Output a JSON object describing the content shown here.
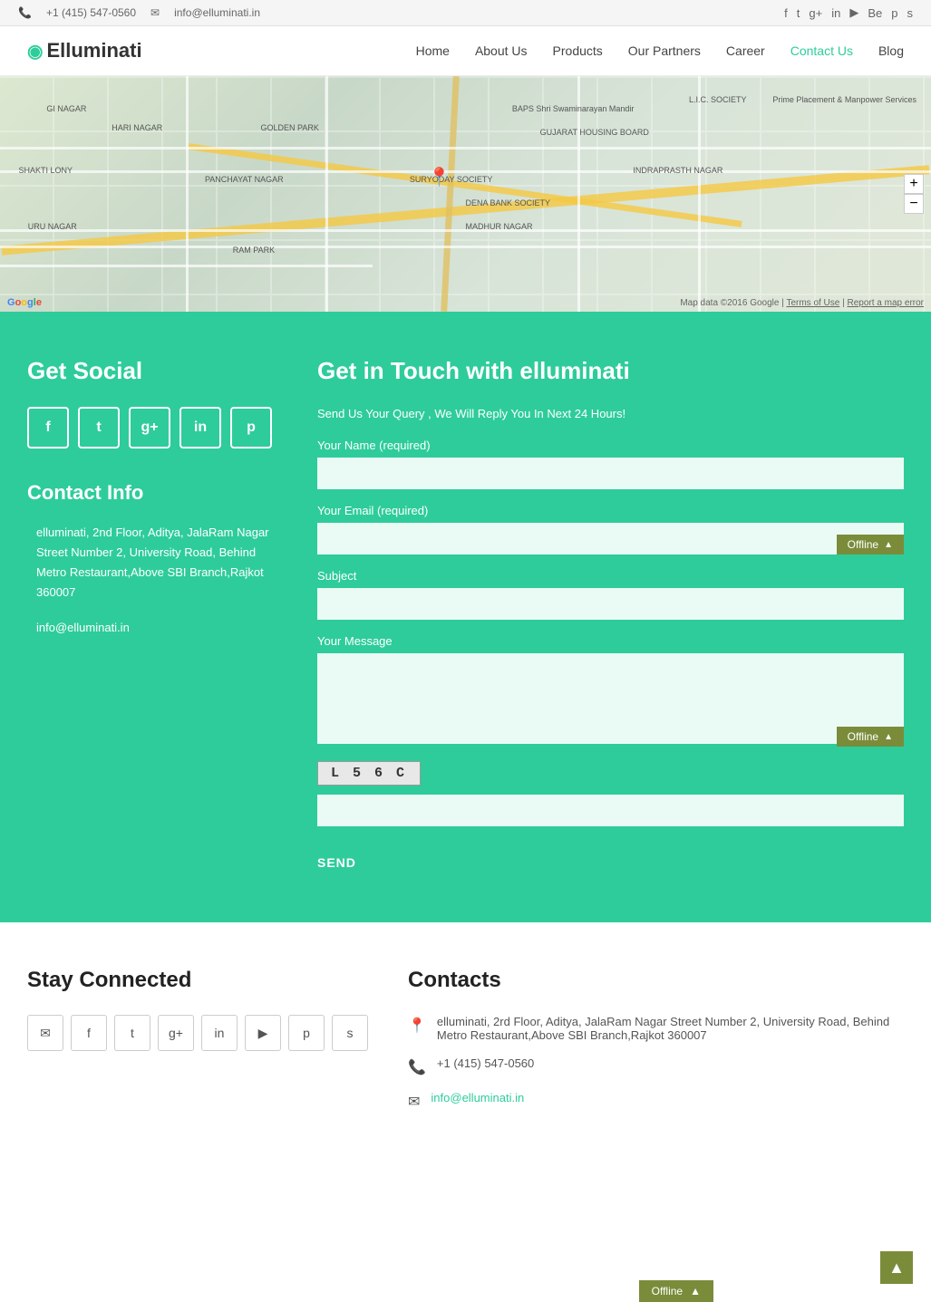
{
  "topbar": {
    "phone": "+1 (415) 547-0560",
    "email": "info@elluminati.in",
    "social_icons": [
      "f",
      "t",
      "g+",
      "in",
      "▶",
      "Be",
      "p",
      "s"
    ]
  },
  "navbar": {
    "logo_text": "Elluminati",
    "links": [
      {
        "label": "Home",
        "active": false
      },
      {
        "label": "About Us",
        "active": false
      },
      {
        "label": "Products",
        "active": false
      },
      {
        "label": "Our Partners",
        "active": false
      },
      {
        "label": "Career",
        "active": false
      },
      {
        "label": "Contact Us",
        "active": true
      },
      {
        "label": "Blog",
        "active": false
      }
    ]
  },
  "map": {
    "copyright": "Map data ©2016 Google",
    "terms": "Terms of Use",
    "report": "Report a map error"
  },
  "get_social": {
    "title": "Get Social",
    "icons": [
      {
        "name": "facebook",
        "symbol": "f"
      },
      {
        "name": "twitter",
        "symbol": "t"
      },
      {
        "name": "google-plus",
        "symbol": "g+"
      },
      {
        "name": "linkedin",
        "symbol": "in"
      },
      {
        "name": "pinterest",
        "symbol": "p"
      }
    ]
  },
  "contact_info": {
    "title": "Contact Info",
    "address": "elluminati, 2nd Floor, Aditya, JalaRam Nagar Street Number 2, University Road, Behind Metro Restaurant,Above SBI Branch,Rajkot 360007",
    "email": "info@elluminati.in"
  },
  "contact_form": {
    "title": "Get in Touch with elluminati",
    "subtitle": "Send Us Your Query , We Will Reply You In Next 24 Hours!",
    "name_label": "Your Name (required)",
    "email_label": "Your Email (required)",
    "subject_label": "Subject",
    "message_label": "Your Message",
    "captcha_text": "L 5 6 C",
    "send_button": "SEND",
    "offline_label": "Offline"
  },
  "footer": {
    "stay_connected_title": "Stay Connected",
    "contacts_title": "Contacts",
    "address": "elluminati, 2rd Floor, Aditya, JalaRam Nagar Street Number 2, University Road, Behind Metro Restaurant,Above SBI Branch,Rajkot 360007",
    "phone": "+1 (415) 547-0560",
    "email": "info@elluminati.in",
    "social_icons": [
      {
        "name": "email",
        "symbol": "✉"
      },
      {
        "name": "facebook",
        "symbol": "f"
      },
      {
        "name": "twitter",
        "symbol": "t"
      },
      {
        "name": "google-plus",
        "symbol": "g+"
      },
      {
        "name": "linkedin",
        "symbol": "in"
      },
      {
        "name": "youtube",
        "symbol": "▶"
      },
      {
        "name": "pinterest",
        "symbol": "p"
      },
      {
        "name": "skype",
        "symbol": "s"
      }
    ],
    "offline_label": "Offline"
  }
}
